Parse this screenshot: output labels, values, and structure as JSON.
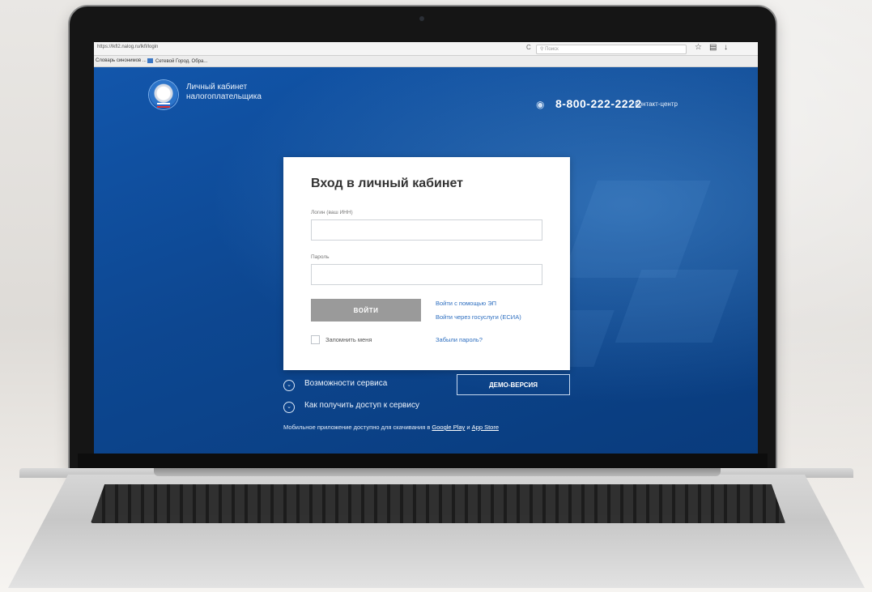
{
  "browser": {
    "url": "https://lkfl2.nalog.ru/lkfl/login",
    "search_placeholder": "Поиск",
    "reload_icon": "C",
    "bookmarks": [
      "Словарь синонимов ...",
      "Сетевой Город. Обра..."
    ]
  },
  "header": {
    "brand_line1": "Личный кабинет",
    "brand_line2": "налогоплательщика",
    "phone": "8-800-222-2222",
    "contact_center": "Контакт-центр"
  },
  "login": {
    "title": "Вход в личный кабинет",
    "login_label": "Логин (ваш ИНН)",
    "password_label": "Пароль",
    "submit": "ВОЙТИ",
    "link_ep": "Войти с помощью ЭП",
    "link_esia": "Войти через госуслуги (ЕСИА)",
    "remember": "Запомнить меня",
    "forgot": "Забыли пароль?"
  },
  "features": {
    "capabilities": "Возможности сервиса",
    "access": "Как получить доступ к сервису",
    "demo": "ДЕМО-ВЕРСИЯ"
  },
  "footer": {
    "mobile_text": "Мобильное приложение доступно для скачивания в ",
    "google_play": "Google Play",
    "and": " и ",
    "app_store": "App Store"
  },
  "colors": {
    "page_blue": "#0e4b98",
    "link": "#2e6fc0",
    "button_gray": "#9a9a9a"
  }
}
